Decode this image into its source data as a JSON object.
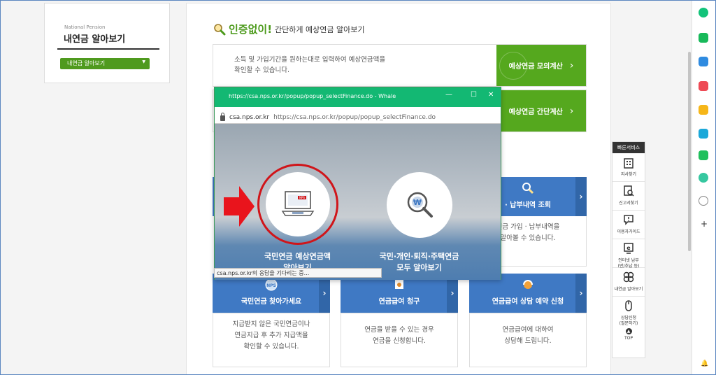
{
  "left_panel": {
    "subtitle_en": "National Pension",
    "title": "내연금 알아보기",
    "select_label": "내연금 알아보기"
  },
  "main": {
    "heading_highlight": "인증없이!",
    "heading_rest": "간단하게 예상연금 알아보기",
    "banner1": {
      "line1": "소득 및 가입기간을 원하는대로 입력하여 예상연금액을",
      "line2": "확인할 수 있습니다.",
      "button": "예상연금 모의계산"
    },
    "banner2": {
      "button": "예상연금 간단계산"
    },
    "services": [
      {
        "label": "· 납부내역 조회",
        "desc1": "연금 가입 · 납부내역을",
        "desc2": "알아볼 수 있습니다."
      },
      {
        "label": "국민연금 찾아가세요",
        "desc1": "지급받지 않은 국민연금이나",
        "desc2": "연금지급 후 추가 지급액을",
        "desc3": "확인할 수 있습니다."
      },
      {
        "label": "연금급여 청구",
        "desc1": "연금을 받을 수 있는 경우",
        "desc2": "연금을 신청합니다."
      },
      {
        "label": "연금급여 상담 예약 신청",
        "desc1": "연금급여에 대하여",
        "desc2": "상담해 드립니다."
      }
    ]
  },
  "popup": {
    "title": "https://csa.nps.or.kr/popup/popup_selectFinance.do - Whale",
    "addr_host": "csa.nps.or.kr",
    "addr_url": "https://csa.nps.or.kr/popup/popup_selectFinance.do",
    "option1_line1": "국민연금 예상연금액",
    "option1_line2": "알아보기",
    "option2_line1": "국민·개인·퇴직·주택연금",
    "option2_line2": "모두 알아보기",
    "laptop_badge": "NPS",
    "won_symbol": "₩",
    "status": "csa.nps.or.kr의 응답을 기다리는 중..."
  },
  "quick": {
    "header": "빠른서비스",
    "items": [
      {
        "label1": "지사찾기"
      },
      {
        "label1": "신고서찾기"
      },
      {
        "label1": "이용자가이드"
      },
      {
        "label1": "인터넷 납부",
        "label2": "(반/추납 등)"
      },
      {
        "label1": "내연금 알아보기"
      },
      {
        "label1": "상담신청",
        "label2": "(질문하기)"
      }
    ],
    "top": "TOP"
  },
  "colors": {
    "green": "#55a81e",
    "blue": "#3f79c4",
    "whale_green": "#13b873",
    "red": "#d0151a"
  }
}
